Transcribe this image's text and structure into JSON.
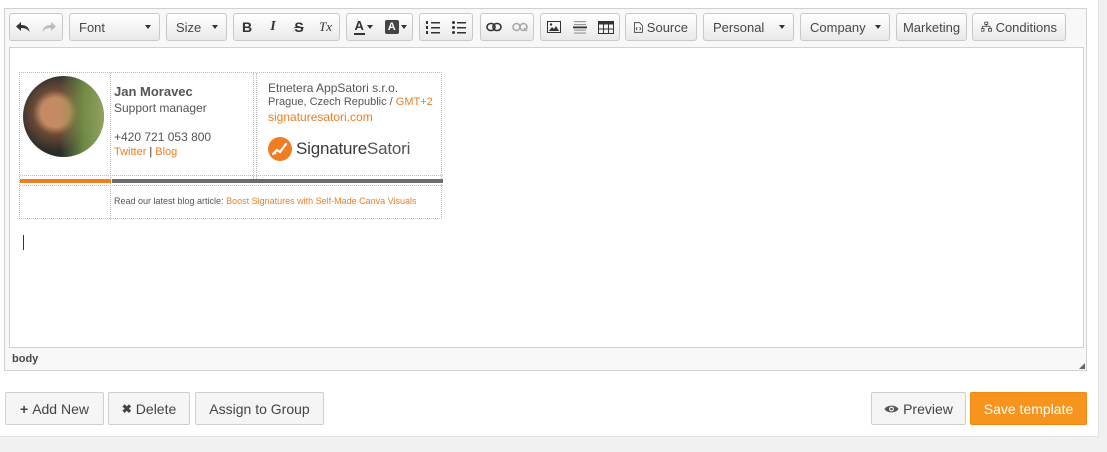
{
  "toolbar": {
    "font_label": "Font",
    "size_label": "Size",
    "personal_label": "Personal",
    "company_label": "Company",
    "marketing_label": "Marketing",
    "conditions_label": "Conditions",
    "source_label": "Source",
    "bold_glyph": "B",
    "italic_glyph": "I",
    "strike_glyph": "S",
    "clear_glyph": "Tx",
    "text_color_glyph": "A",
    "bg_color_glyph": "A"
  },
  "signature": {
    "name": "Jan Moravec",
    "title": "Support manager",
    "phone": "+420 721 053 800",
    "link1": "Twitter",
    "link_separator": "|",
    "link2": "Blog",
    "company": "Etnetera AppSatori s.r.o.",
    "location": "Prague, Czech Republic / ",
    "timezone": "GMT+2",
    "website": "signaturesatori.com",
    "logo_part1": "Signature",
    "logo_part2": "Satori",
    "blog_prefix": "Read our latest blog article: ",
    "blog_link": "Boost Signatures with Self-Made Canva Visuals"
  },
  "status_path": "body",
  "actions": {
    "add_new": "Add New",
    "delete": "Delete",
    "assign": "Assign to Group",
    "preview": "Preview",
    "save": "Save template"
  },
  "colors": {
    "accent": "#f7941d",
    "link": "#ef7d22",
    "stripe_dark": "#6b6b6b"
  }
}
